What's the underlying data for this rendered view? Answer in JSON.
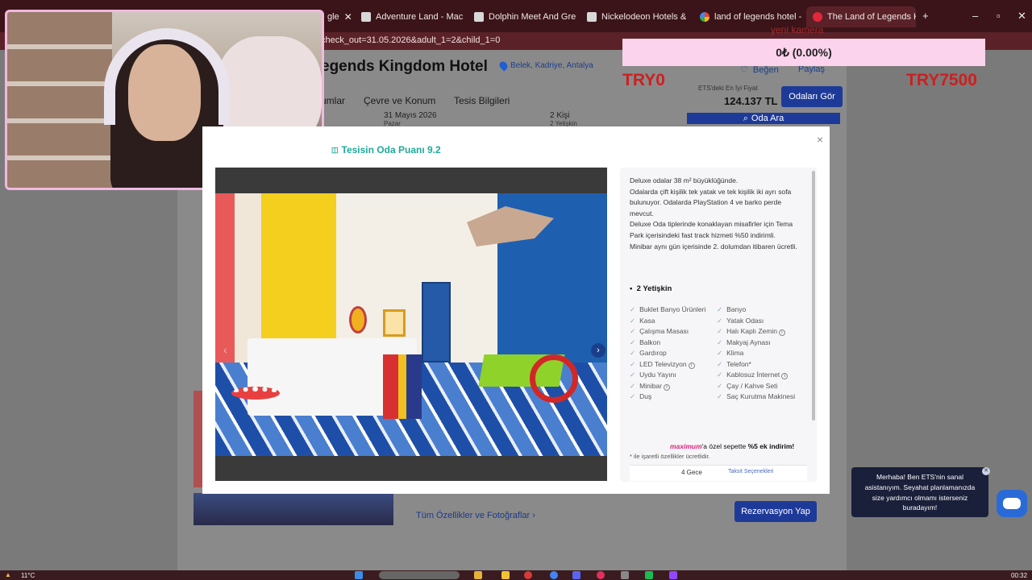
{
  "browser": {
    "tabs": [
      {
        "label": "gle",
        "icon": "page-icon"
      },
      {
        "label": "Adventure Land - Macera",
        "icon": "page-icon"
      },
      {
        "label": "Dolphin Meet And Greet",
        "icon": "page-icon"
      },
      {
        "label": "Nickelodeon Hotels & Re",
        "icon": "page-icon"
      },
      {
        "label": "land of legends hotel - G",
        "icon": "google-icon"
      },
      {
        "label": "The Land of Legends King",
        "icon": "ets-icon"
      }
    ],
    "new_tab": "+",
    "url": "check_out=31.05.2026&adult_1=2&child_1=0"
  },
  "hotel": {
    "name": "egends Kingdom Hotel",
    "location": "Belek, Kadriye, Antalya",
    "nav": [
      "umlar",
      "Çevre ve Konum",
      "Tesis Bilgileri"
    ],
    "date": "31 Mayıs 2026",
    "date_sub": "Pazar",
    "guests": "2 Kişi",
    "guests_sub": "2 Yetişkin",
    "favorite": "Beğen",
    "share": "Paylaş",
    "price_label": "ETS'deki En İyi Fiyat",
    "price": "124.137 TL",
    "rooms_button": "Odaları Gör",
    "search_button": "Oda Ara",
    "all_features": "Tüm Özellikler ve Fotoğraflar",
    "reserve_button": "Rezervasyon Yap"
  },
  "stream": {
    "donation": "0₺ (0.00%)",
    "goal_left": "TRY0",
    "goal_right": "TRY7500",
    "ghost": "yeni kamera"
  },
  "modal": {
    "title": "Tesisin Oda Puanı 9.2",
    "close": "×",
    "prev": "‹",
    "next": "›",
    "description": [
      "Deluxe odalar 38 m² büyüklüğünde.",
      "Odalarda çift kişilik tek yatak ve tek kişilik iki ayrı sofa bulunuyor. Odalarda PlayStation 4 ve barko perde mevcut.",
      "Deluxe Oda tiplerinde konaklayan misafirler için Tema Park içerisindeki fast track hizmeti %50 indirimli.",
      "Minibar aynı gün içerisinde 2. dolumdan itibaren ücretli."
    ],
    "guests": "2 Yetişkin",
    "amenities_left": [
      "Buklet Banyo Ürünleri",
      "Kasa",
      "Çalışma Masası",
      "Balkon",
      "Gardırop",
      "LED Televizyon",
      "Uydu Yayını",
      "Minibar",
      "Duş"
    ],
    "amenities_right": [
      "Banyo",
      "Yatak Odası",
      "Halı Kaplı Zemin",
      "Makyaj Aynası",
      "Klima",
      "Telefon*",
      "Kablosuz İnternet",
      "Çay / Kahve Seti",
      "Saç Kurutma Makinesi"
    ],
    "note": "* ile işaretli özellikler ücretlidir.",
    "maximum_brand": "maximum",
    "maximum_text": "'a özel sepette",
    "maximum_bold": "%5 ek indirim!",
    "nights": "4 Gece",
    "installments": "Taksit Seçenekleri"
  },
  "chat": {
    "text": "Merhaba! Ben ETS'nin sanal asistanıyım. Seyahat planlamanızda size yardımcı olmamı isterseniz buradayım!"
  },
  "taskbar": {
    "weather": "11°C",
    "clock": "00:32"
  }
}
